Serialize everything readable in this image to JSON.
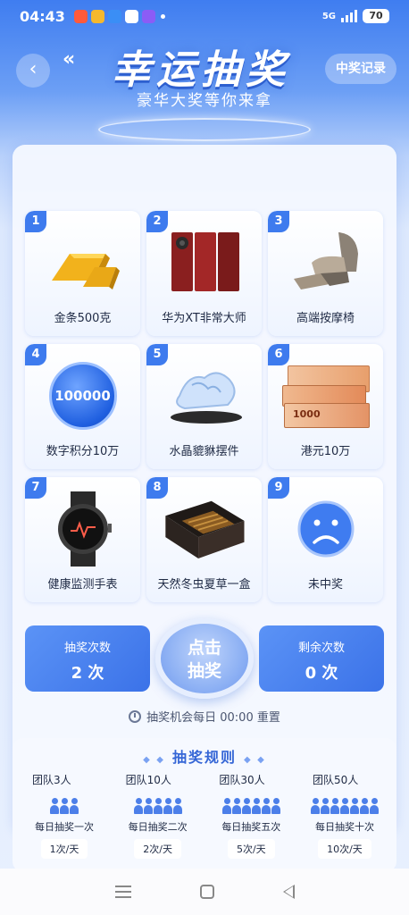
{
  "status_bar": {
    "time": "04:43",
    "network": "5G",
    "battery": "70",
    "app_icons": [
      "#ff5a3c",
      "#f5b82e",
      "#3a8ef6",
      "#ffffff",
      "#8b5cf6"
    ]
  },
  "header": {
    "title": "幸运抽奖",
    "subtitle": "豪华大奖等你来拿",
    "records_label": "中奖记录",
    "back_icon": "chevron-left-icon"
  },
  "prizes": [
    {
      "num": "1",
      "label": "金条500克"
    },
    {
      "num": "2",
      "label": "华为XT非常大师"
    },
    {
      "num": "3",
      "label": "高端按摩椅"
    },
    {
      "num": "4",
      "label": "数字积分10万",
      "coin_text": "100000"
    },
    {
      "num": "5",
      "label": "水晶貔貅摆件"
    },
    {
      "num": "6",
      "label": "港元10万",
      "note_text": "1000"
    },
    {
      "num": "7",
      "label": "健康监测手表"
    },
    {
      "num": "8",
      "label": "天然冬虫夏草一盒"
    },
    {
      "num": "9",
      "label": "未中奖"
    }
  ],
  "draw": {
    "used_label": "抽奖次数",
    "used_value": "2 次",
    "button_line1": "点击",
    "button_line2": "抽奖",
    "remaining_label": "剩余次数",
    "remaining_value": "0 次",
    "reset_note": "抽奖机会每日 00:00 重置"
  },
  "rules": {
    "title": "抽奖规则",
    "items": [
      {
        "team": "团队3人",
        "desc": "每日抽奖一次",
        "rate": "1次/天",
        "people": 3
      },
      {
        "team": "团队10人",
        "desc": "每日抽奖二次",
        "rate": "2次/天",
        "people": 5
      },
      {
        "team": "团队30人",
        "desc": "每日抽奖五次",
        "rate": "5次/天",
        "people": 6
      },
      {
        "team": "团队50人",
        "desc": "每日抽奖十次",
        "rate": "10次/天",
        "people": 7
      }
    ]
  },
  "colors": {
    "accent": "#3e7bee",
    "background_top": "#3f7df0",
    "card": "#f4f8ff"
  }
}
